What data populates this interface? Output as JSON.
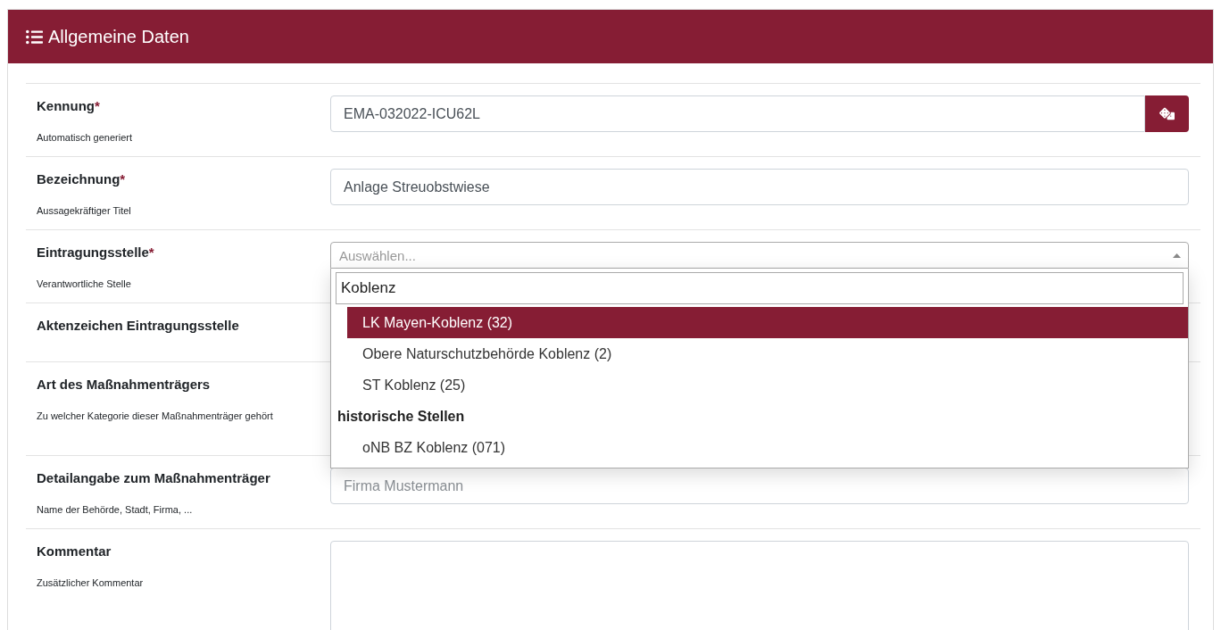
{
  "header": {
    "title": "Allgemeine Daten"
  },
  "fields": [
    {
      "kind": "text",
      "label": "Kennung",
      "required_mark": "*",
      "help": "Automatisch generiert",
      "value": "EMA-032022-ICU62L",
      "generate_button": true
    },
    {
      "kind": "text",
      "label": "Bezeichnung",
      "required_mark": "*",
      "help": "Aussagekräftiger Titel",
      "value": "Anlage Streuobstwiese"
    },
    {
      "kind": "select",
      "label": "Eintragungsstelle",
      "required_mark": "*",
      "help": "Verantwortliche Stelle",
      "placeholder": "Auswählen...",
      "open": true,
      "dropdown": {
        "search": "Koblenz",
        "items": [
          {
            "kind": "option",
            "label": "LK Mayen-Koblenz (32)",
            "selected": true
          },
          {
            "kind": "option",
            "label": "Obere Naturschutzbehörde Koblenz (2)",
            "selected": false
          },
          {
            "kind": "option",
            "label": "ST Koblenz (25)",
            "selected": false
          },
          {
            "kind": "group",
            "label": "historische Stellen",
            "children": [
              {
                "kind": "option",
                "label": "oNB BZ Koblenz (071)",
                "selected": false
              }
            ]
          }
        ]
      }
    },
    {
      "kind": "none",
      "label": "Aktenzeichen Eintragungsstelle"
    },
    {
      "kind": "none",
      "label": "Art des Maßnahmenträgers",
      "help": "Zu welcher Kategorie dieser Maßnahmenträger gehört"
    },
    {
      "kind": "text",
      "label": "Detailangabe zum Maßnahmenträger",
      "help": "Name der Behörde, Stadt, Firma, ...",
      "placeholder": "Firma Mustermann"
    },
    {
      "kind": "textarea",
      "label": "Kommentar",
      "help": "Zusätzlicher Kommentar"
    }
  ]
}
